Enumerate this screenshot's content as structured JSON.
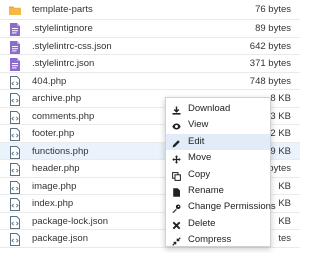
{
  "files": [
    {
      "icon": "folder-icon",
      "name": "template-parts",
      "size": "76 bytes"
    },
    {
      "icon": "text-file-icon",
      "name": ".stylelintignore",
      "size": "89 bytes"
    },
    {
      "icon": "text-file-icon",
      "name": ".stylelintrc-css.json",
      "size": "642 bytes"
    },
    {
      "icon": "text-file-icon",
      "name": ".stylelintrc.json",
      "size": "371 bytes"
    },
    {
      "icon": "code-file-icon",
      "name": "404.php",
      "size": "748 bytes"
    },
    {
      "icon": "code-file-icon",
      "name": "archive.php",
      "size": ".8 KB"
    },
    {
      "icon": "code-file-icon",
      "name": "comments.php",
      "size": ".3 KB"
    },
    {
      "icon": "code-file-icon",
      "name": "footer.php",
      "size": "2 KB"
    },
    {
      "icon": "code-file-icon",
      "name": "functions.php",
      "size": "79 KB",
      "selected": true
    },
    {
      "icon": "code-file-icon",
      "name": "header.php",
      "size": "14 bytes"
    },
    {
      "icon": "code-file-icon",
      "name": "image.php",
      "size": "KB"
    },
    {
      "icon": "code-file-icon",
      "name": "index.php",
      "size": "KB"
    },
    {
      "icon": "code-file-icon",
      "name": "package-lock.json",
      "size": "KB"
    },
    {
      "icon": "code-file-icon",
      "name": "package.json",
      "size": "tes"
    }
  ],
  "context_menu": [
    {
      "icon": "download-icon",
      "label": "Download"
    },
    {
      "icon": "eye-icon",
      "label": "View"
    },
    {
      "icon": "pencil-icon",
      "label": "Edit",
      "hover": true
    },
    {
      "icon": "move-icon",
      "label": "Move"
    },
    {
      "icon": "copy-icon",
      "label": "Copy"
    },
    {
      "icon": "rename-icon",
      "label": "Rename"
    },
    {
      "icon": "key-icon",
      "label": "Change Permissions"
    },
    {
      "icon": "delete-icon",
      "label": "Delete"
    },
    {
      "icon": "compress-icon",
      "label": "Compress"
    }
  ],
  "colors": {
    "folder": "#e9a93a",
    "text_file": "#8c6ccf",
    "code_file_border": "#5c7080",
    "selected_row": "#eaf2fb",
    "menu_hover": "#e1ecf8"
  }
}
